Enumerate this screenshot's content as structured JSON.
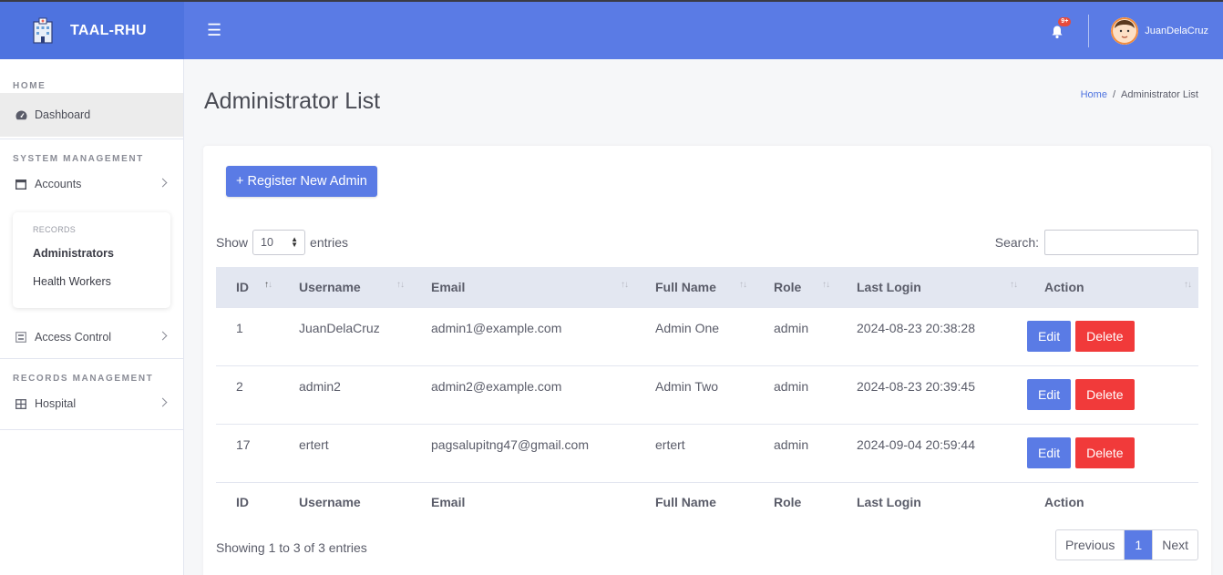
{
  "app": {
    "brand": "TAAL-RHU"
  },
  "header": {
    "notification_badge": "9+",
    "user_name": "JuanDelaCruz"
  },
  "sidebar": {
    "home_heading": "HOME",
    "dashboard": "Dashboard",
    "system_heading": "SYSTEM MANAGEMENT",
    "accounts": "Accounts",
    "submenu_heading": "RECORDS",
    "administrators": "Administrators",
    "health_workers": "Health Workers",
    "access_control": "Access Control",
    "records_heading": "RECORDS MANAGEMENT",
    "hospital": "Hospital"
  },
  "page": {
    "title": "Administrator List",
    "breadcrumb_home": "Home",
    "breadcrumb_current": "Administrator List"
  },
  "toolbar": {
    "register_label": "+ Register New Admin",
    "show_label": "Show",
    "entries_value": "10",
    "entries_label": "entries",
    "search_label": "Search:",
    "search_value": ""
  },
  "table": {
    "columns": [
      "ID",
      "Username",
      "Email",
      "Full Name",
      "Role",
      "Last Login",
      "Action"
    ],
    "rows": [
      {
        "id": "1",
        "username": "JuanDelaCruz",
        "email": "admin1@example.com",
        "full_name": "Admin One",
        "role": "admin",
        "last_login": "2024-08-23 20:38:28"
      },
      {
        "id": "2",
        "username": "admin2",
        "email": "admin2@example.com",
        "full_name": "Admin Two",
        "role": "admin",
        "last_login": "2024-08-23 20:39:45"
      },
      {
        "id": "17",
        "username": "ertert",
        "email": "pagsalupitng47@gmail.com",
        "full_name": "ertert",
        "role": "admin",
        "last_login": "2024-09-04 20:59:44"
      }
    ],
    "edit_label": "Edit",
    "delete_label": "Delete"
  },
  "footer": {
    "info": "Showing 1 to 3 of 3 entries",
    "prev": "Previous",
    "current_page": "1",
    "next": "Next"
  },
  "colors": {
    "primary": "#4e73df",
    "navbar": "#5a7be5",
    "danger": "#f13a3a"
  }
}
